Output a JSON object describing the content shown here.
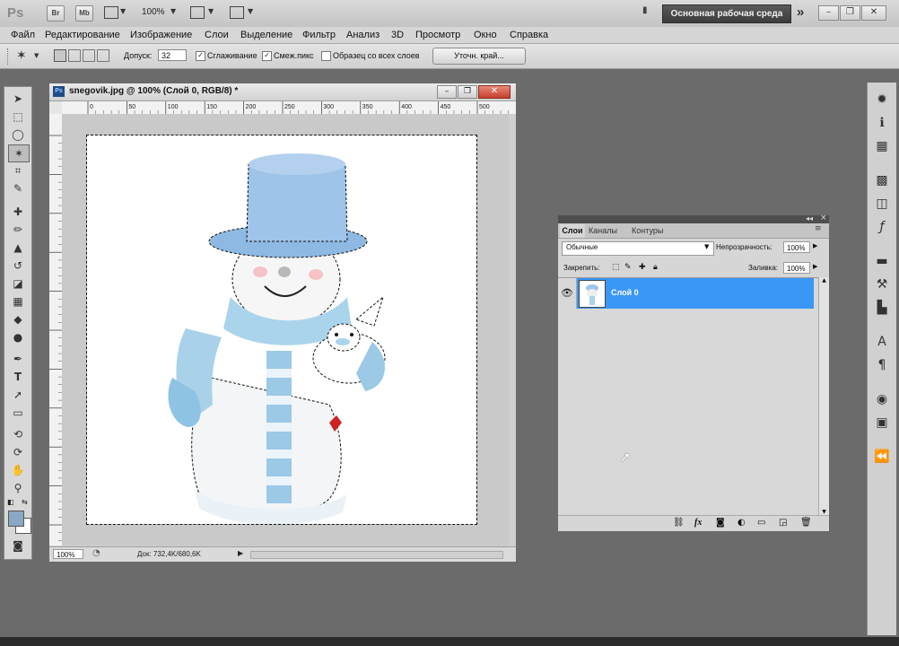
{
  "app": {
    "logo": "Ps",
    "launchers": [
      "Br",
      "Mb"
    ],
    "zoom": "100%",
    "workspace": "Основная рабочая среда",
    "more": "»"
  },
  "menu": [
    "Файл",
    "Редактирование",
    "Изображение",
    "Слои",
    "Выделение",
    "Фильтр",
    "Анализ",
    "3D",
    "Просмотр",
    "Окно",
    "Справка"
  ],
  "options": {
    "tolerance_label": "Допуск:",
    "tolerance_value": "32",
    "antialias_label": "Сглаживание",
    "contiguous_label": "Смеж.пикс",
    "sample_all_label": "Образец со всех слоев",
    "refine_edge_label": "Уточн. край..."
  },
  "document": {
    "title": "snegovik.jpg @ 100% (Слой 0, RGB/8) *",
    "icon": "Ps",
    "ruler_ticks": [
      "0",
      "50",
      "100",
      "150",
      "200",
      "250",
      "300",
      "350",
      "400",
      "450",
      "500"
    ],
    "zoom": "100%",
    "doc_info": "Док: 732,4K/680,6K"
  },
  "layers_panel": {
    "tabs": [
      "Слои",
      "Каналы",
      "Контуры"
    ],
    "blend_mode": "Обычные",
    "opacity_label": "Непрозрачность:",
    "opacity_value": "100%",
    "lock_label": "Закрепить:",
    "fill_label": "Заливка:",
    "fill_value": "100%",
    "layer_name": "Слой 0",
    "collapse": "◂◂",
    "close": "×"
  },
  "colors": {
    "selected_layer": "#3a97f5",
    "foreground": "#8aa7c4",
    "background": "#ffffff"
  },
  "icons": {
    "visibility": "eye-icon"
  }
}
